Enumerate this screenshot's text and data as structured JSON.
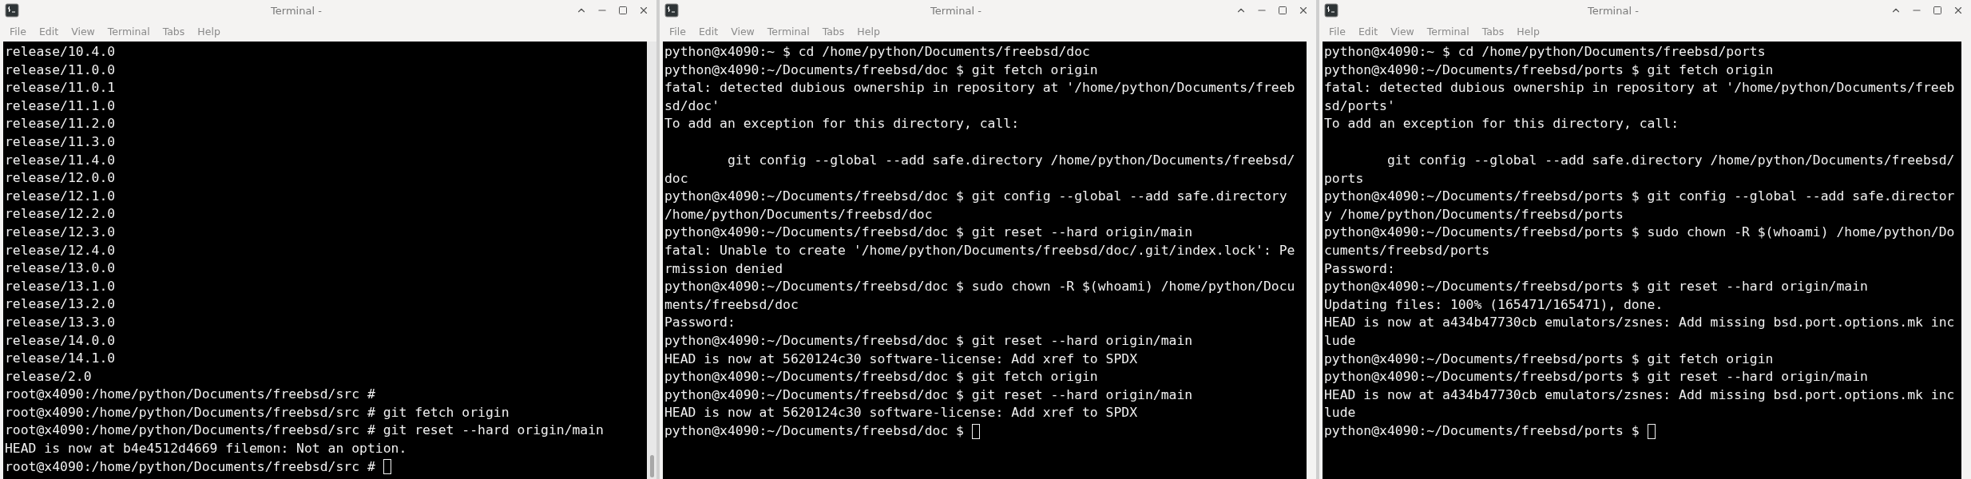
{
  "windows": [
    {
      "title": "Terminal -",
      "menu": [
        "File",
        "Edit",
        "View",
        "Terminal",
        "Tabs",
        "Help"
      ],
      "cursor_visible": true,
      "scrollbar": true,
      "lines": [
        {
          "text": "release/10.4.0"
        },
        {
          "text": "release/11.0.0"
        },
        {
          "text": "release/11.0.1"
        },
        {
          "text": "release/11.1.0"
        },
        {
          "text": "release/11.2.0"
        },
        {
          "text": "release/11.3.0"
        },
        {
          "text": "release/11.4.0"
        },
        {
          "text": "release/12.0.0"
        },
        {
          "text": "release/12.1.0"
        },
        {
          "text": "release/12.2.0"
        },
        {
          "text": "release/12.3.0"
        },
        {
          "text": "release/12.4.0"
        },
        {
          "text": "release/13.0.0"
        },
        {
          "text": "release/13.1.0"
        },
        {
          "text": "release/13.2.0"
        },
        {
          "text": "release/13.3.0"
        },
        {
          "text": "release/14.0.0"
        },
        {
          "text": "release/14.1.0"
        },
        {
          "text": "release/2.0"
        },
        {
          "text": "root@x4090:/home/python/Documents/freebsd/src #"
        },
        {
          "text": "root@x4090:/home/python/Documents/freebsd/src # git fetch origin"
        },
        {
          "text": "root@x4090:/home/python/Documents/freebsd/src # git reset --hard origin/main"
        },
        {
          "text": "HEAD is now at b4e4512d4669 filemon: Not an option."
        },
        {
          "text": "root@x4090:/home/python/Documents/freebsd/src #"
        }
      ]
    },
    {
      "title": "Terminal -",
      "menu": [
        "File",
        "Edit",
        "View",
        "Terminal",
        "Tabs",
        "Help"
      ],
      "cursor_visible": true,
      "scrollbar": false,
      "lines": [
        {
          "text": "python@x4090:~ $ cd /home/python/Documents/freebsd/doc"
        },
        {
          "text": "python@x4090:~/Documents/freebsd/doc $ git fetch origin"
        },
        {
          "text": "fatal: detected dubious ownership in repository at '/home/python/Documents/freeb"
        },
        {
          "text": "sd/doc'"
        },
        {
          "text": "To add an exception for this directory, call:"
        },
        {
          "text": "        git config --global --add safe.directory /home/python/Documents/freebsd/",
          "blank_before": true
        },
        {
          "text": "doc"
        },
        {
          "text": "python@x4090:~/Documents/freebsd/doc $ git config --global --add safe.directory"
        },
        {
          "text": "/home/python/Documents/freebsd/doc"
        },
        {
          "text": "python@x4090:~/Documents/freebsd/doc $ git reset --hard origin/main"
        },
        {
          "text": "fatal: Unable to create '/home/python/Documents/freebsd/doc/.git/index.lock': Pe"
        },
        {
          "text": "rmission denied"
        },
        {
          "text": "python@x4090:~/Documents/freebsd/doc $ sudo chown -R $(whoami) /home/python/Docu"
        },
        {
          "text": "ments/freebsd/doc"
        },
        {
          "text": "Password:"
        },
        {
          "text": "python@x4090:~/Documents/freebsd/doc $ git reset --hard origin/main"
        },
        {
          "text": "HEAD is now at 5620124c30 software-license: Add xref to SPDX"
        },
        {
          "text": "python@x4090:~/Documents/freebsd/doc $ git fetch origin"
        },
        {
          "text": "python@x4090:~/Documents/freebsd/doc $ git reset --hard origin/main"
        },
        {
          "text": "HEAD is now at 5620124c30 software-license: Add xref to SPDX"
        },
        {
          "text": "python@x4090:~/Documents/freebsd/doc $"
        }
      ]
    },
    {
      "title": "Terminal -",
      "menu": [
        "File",
        "Edit",
        "View",
        "Terminal",
        "Tabs",
        "Help"
      ],
      "cursor_visible": true,
      "scrollbar": false,
      "lines": [
        {
          "text": "python@x4090:~ $ cd /home/python/Documents/freebsd/ports"
        },
        {
          "text": "python@x4090:~/Documents/freebsd/ports $ git fetch origin"
        },
        {
          "text": "fatal: detected dubious ownership in repository at '/home/python/Documents/freeb"
        },
        {
          "text": "sd/ports'"
        },
        {
          "text": "To add an exception for this directory, call:"
        },
        {
          "text": "        git config --global --add safe.directory /home/python/Documents/freebsd/",
          "blank_before": true
        },
        {
          "text": "ports"
        },
        {
          "text": "python@x4090:~/Documents/freebsd/ports $ git config --global --add safe.director"
        },
        {
          "text": "y /home/python/Documents/freebsd/ports"
        },
        {
          "text": "python@x4090:~/Documents/freebsd/ports $ sudo chown -R $(whoami) /home/python/Do"
        },
        {
          "text": "cuments/freebsd/ports"
        },
        {
          "text": "Password:"
        },
        {
          "text": "python@x4090:~/Documents/freebsd/ports $ git reset --hard origin/main"
        },
        {
          "text": "Updating files: 100% (165471/165471), done."
        },
        {
          "text": "HEAD is now at a434b47730cb emulators/zsnes: Add missing bsd.port.options.mk inc"
        },
        {
          "text": "lude"
        },
        {
          "text": "python@x4090:~/Documents/freebsd/ports $ git fetch origin"
        },
        {
          "text": "python@x4090:~/Documents/freebsd/ports $ git reset --hard origin/main"
        },
        {
          "text": "HEAD is now at a434b47730cb emulators/zsnes: Add missing bsd.port.options.mk inc"
        },
        {
          "text": "lude"
        },
        {
          "text": "python@x4090:~/Documents/freebsd/ports $"
        }
      ]
    }
  ]
}
